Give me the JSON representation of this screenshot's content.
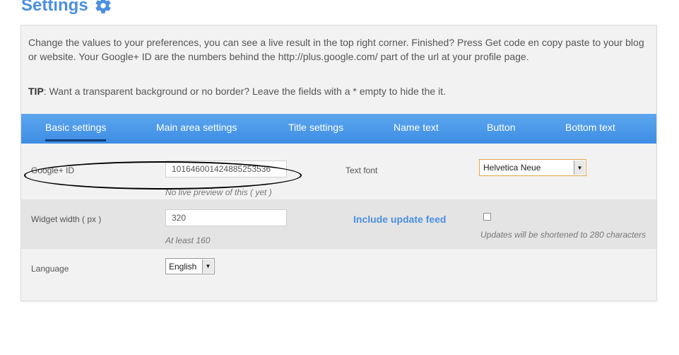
{
  "page": {
    "title": "Settings",
    "gear_icon": "gear-icon",
    "accent": "#4a8fe0",
    "tab_bar_color": "#3d8de5"
  },
  "intro": {
    "text": "Change the values to your preferences, you can see a live result in the top right corner. Finished? Press Get code en copy paste to your blog or website. Your Google+ ID are the numbers behind the http://plus.google.com/ part of the url at your profile page.",
    "tip_label": "TIP",
    "tip_text": ": Want a transparent background or no border? Leave the fields with a * empty to hide the it."
  },
  "tabs": [
    {
      "label": "Basic settings",
      "active": true
    },
    {
      "label": "Main area settings"
    },
    {
      "label": "Title settings"
    },
    {
      "label": "Name text"
    },
    {
      "label": "Button"
    },
    {
      "label": "Bottom text"
    }
  ],
  "form": {
    "google_id": {
      "label": "Google+ ID",
      "value": "101646001424885253536",
      "hint": "No live preview of this ( yet )"
    },
    "text_font": {
      "label": "Text font",
      "selected": "Helvetica Neue"
    },
    "widget_width": {
      "label": "Widget width ( px )",
      "value": "320",
      "hint": "At least 160"
    },
    "update_feed": {
      "label": "Include update feed",
      "checked": false,
      "hint": "Updates will be shortened to 280 characters"
    },
    "language": {
      "label": "Language",
      "selected": "English"
    }
  }
}
